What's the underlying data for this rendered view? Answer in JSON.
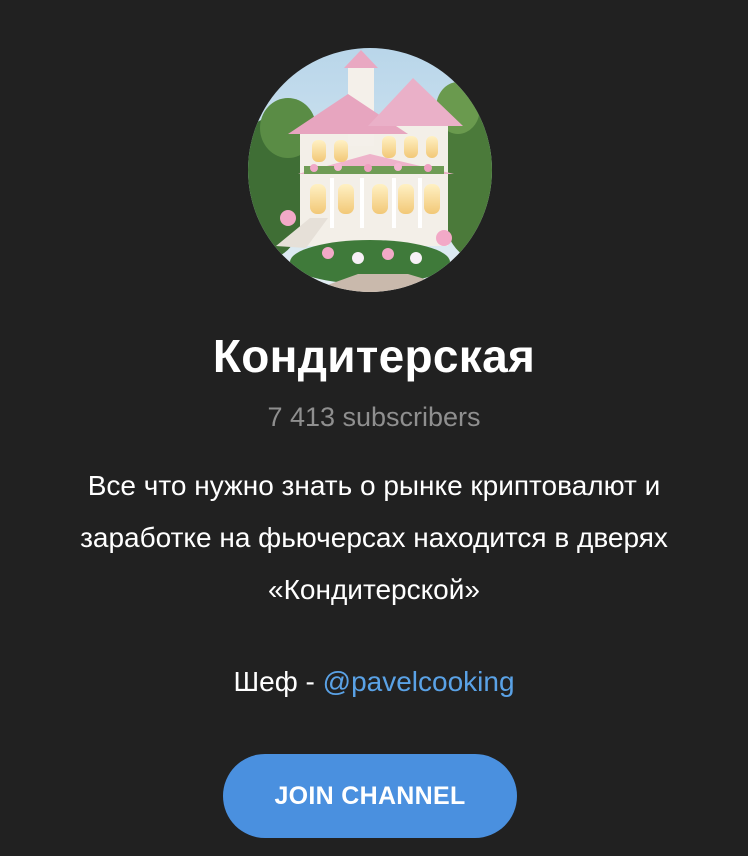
{
  "channel": {
    "title": "Кондитерская",
    "subscribers": "7 413 subscribers",
    "avatar_icon": "pastel-mansion-avatar",
    "description_lines": [
      "Все что нужно знать о рынке криптовалют и",
      "заработке на фьючерсах находится в дверях",
      "«Кондитерской»"
    ],
    "chef_prefix": "Шеф - ",
    "chef_handle": "@pavelcooking"
  },
  "actions": {
    "join_label": "JOIN CHANNEL"
  },
  "colors": {
    "background": "#212121",
    "link": "#5aa2e6",
    "button": "#4a90df",
    "muted_text": "#8f8f8f"
  }
}
